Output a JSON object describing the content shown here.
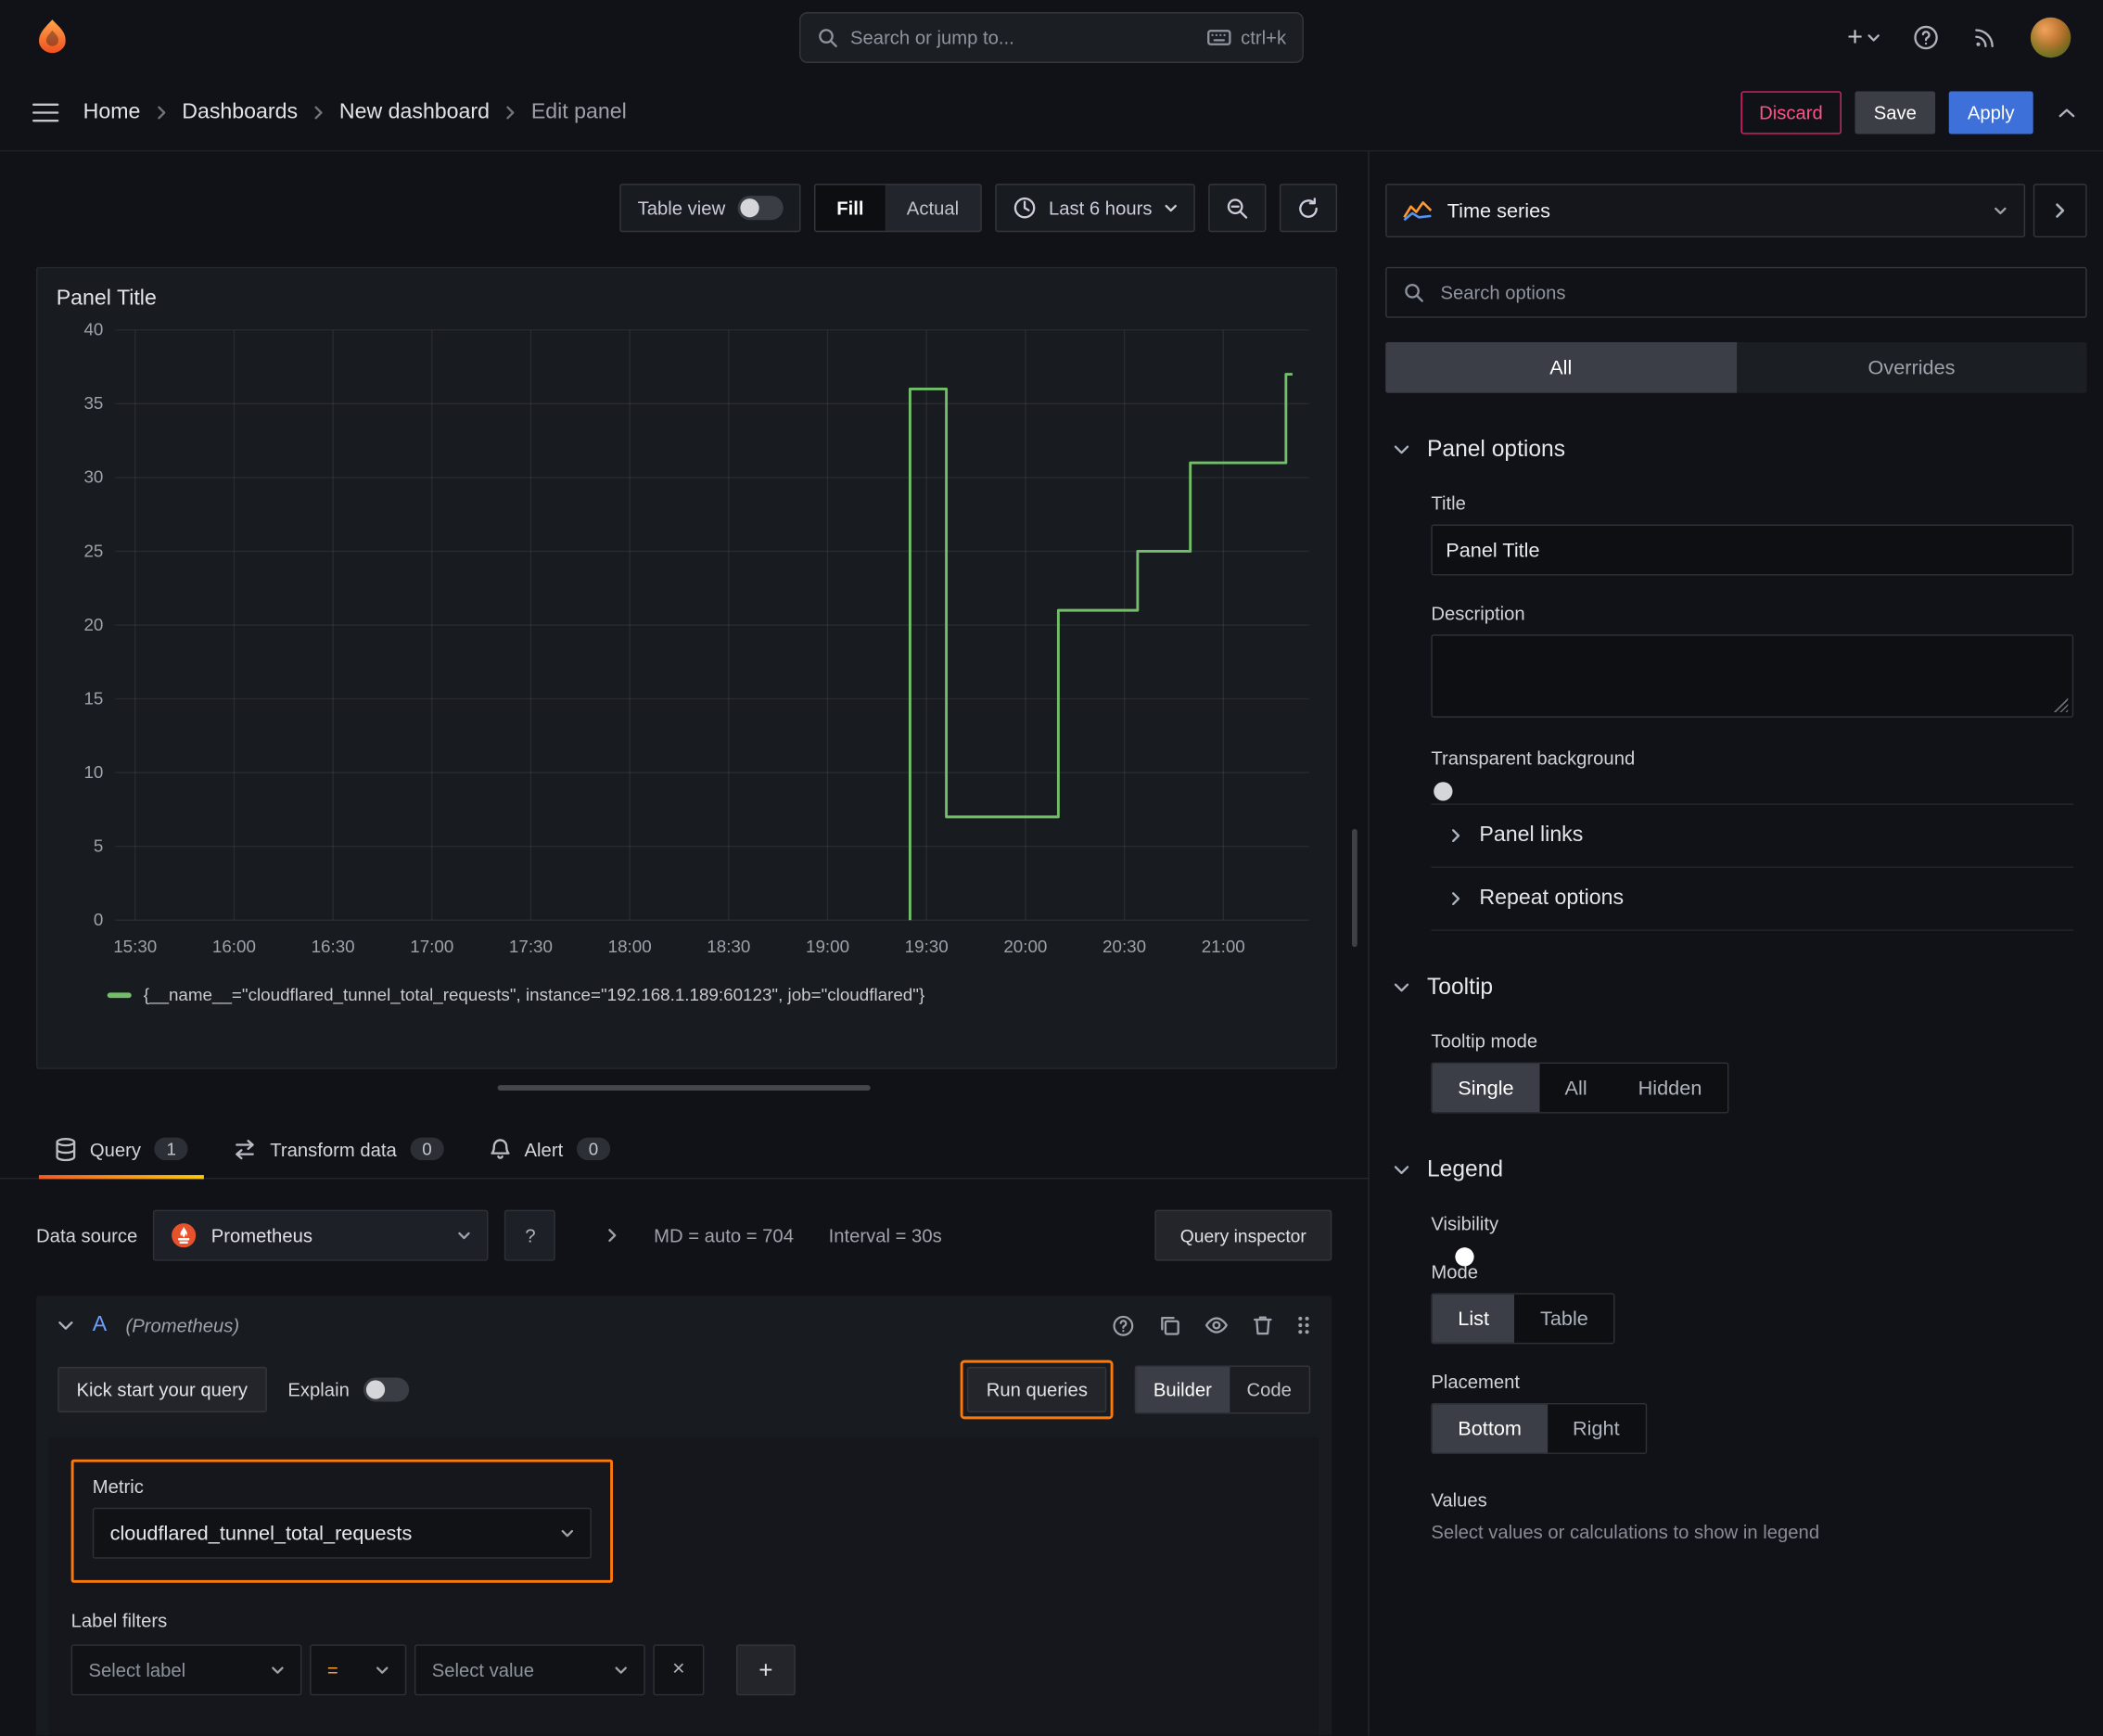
{
  "colors": {
    "accent_orange": "#ff780a",
    "series_green": "#73bf69",
    "primary_blue": "#3d71d9",
    "danger_red": "#ff5286"
  },
  "glyphs": {
    "plus": "+",
    "close": "×",
    "question": "?"
  },
  "topbar": {
    "search_placeholder": "Search or jump to...",
    "shortcut": "ctrl+k"
  },
  "nav": {
    "breadcrumbs": [
      "Home",
      "Dashboards",
      "New dashboard",
      "Edit panel"
    ],
    "discard": "Discard",
    "save": "Save",
    "apply": "Apply"
  },
  "toolbar": {
    "table_view": "Table view",
    "fill": "Fill",
    "actual": "Actual",
    "time_range": "Last 6 hours"
  },
  "panel": {
    "title": "Panel Title"
  },
  "tabs": {
    "query": "Query",
    "query_count": "1",
    "transform": "Transform data",
    "transform_count": "0",
    "alert": "Alert",
    "alert_count": "0"
  },
  "datasource": {
    "label": "Data source",
    "name": "Prometheus",
    "md": "MD = auto = 704",
    "interval": "Interval = 30s",
    "inspector": "Query inspector"
  },
  "query": {
    "ref": "A",
    "hint": "(Prometheus)",
    "kick_start": "Kick start your query",
    "explain": "Explain",
    "run": "Run queries",
    "builder": "Builder",
    "code": "Code",
    "metric_label": "Metric",
    "metric": "cloudflared_tunnel_total_requests",
    "label_filters": "Label filters",
    "select_label": "Select label",
    "op": "=",
    "select_value": "Select value"
  },
  "options": {
    "viz": "Time series",
    "search_placeholder": "Search options",
    "all": "All",
    "overrides": "Overrides",
    "panel_options": "Panel options",
    "title_label": "Title",
    "title_value": "Panel Title",
    "description_label": "Description",
    "transparent_label": "Transparent background",
    "panel_links": "Panel links",
    "repeat_options": "Repeat options",
    "tooltip": "Tooltip",
    "tooltip_mode": "Tooltip mode",
    "tooltip_opts": [
      "Single",
      "All",
      "Hidden"
    ],
    "legend": "Legend",
    "visibility": "Visibility",
    "mode": "Mode",
    "mode_opts": [
      "List",
      "Table"
    ],
    "placement": "Placement",
    "placement_opts": [
      "Bottom",
      "Right"
    ],
    "values": "Values",
    "values_hint": "Select values or calculations to show in legend"
  },
  "chart_data": {
    "type": "line",
    "title": "Panel Title",
    "ylim": [
      0,
      40
    ],
    "y_ticks": [
      0,
      5,
      10,
      15,
      20,
      25,
      30,
      35,
      40
    ],
    "x_ticks": [
      "15:30",
      "16:00",
      "16:30",
      "17:00",
      "17:30",
      "18:00",
      "18:30",
      "19:00",
      "19:30",
      "20:00",
      "20:30",
      "21:00"
    ],
    "x_range": [
      "15:24",
      "21:26"
    ],
    "grid": true,
    "legend_position": "bottom",
    "series": [
      {
        "name": "{__name__=\"cloudflared_tunnel_total_requests\", instance=\"192.168.1.189:60123\", job=\"cloudflared\"}",
        "color": "#73bf69",
        "points": [
          [
            "19:25",
            0
          ],
          [
            "19:25",
            36
          ],
          [
            "19:36",
            36
          ],
          [
            "19:36",
            7
          ],
          [
            "20:10",
            7
          ],
          [
            "20:10",
            21
          ],
          [
            "20:34",
            21
          ],
          [
            "20:34",
            25
          ],
          [
            "20:50",
            25
          ],
          [
            "20:50",
            31
          ],
          [
            "21:19",
            31
          ],
          [
            "21:19",
            37
          ],
          [
            "21:21",
            37
          ]
        ]
      }
    ]
  }
}
